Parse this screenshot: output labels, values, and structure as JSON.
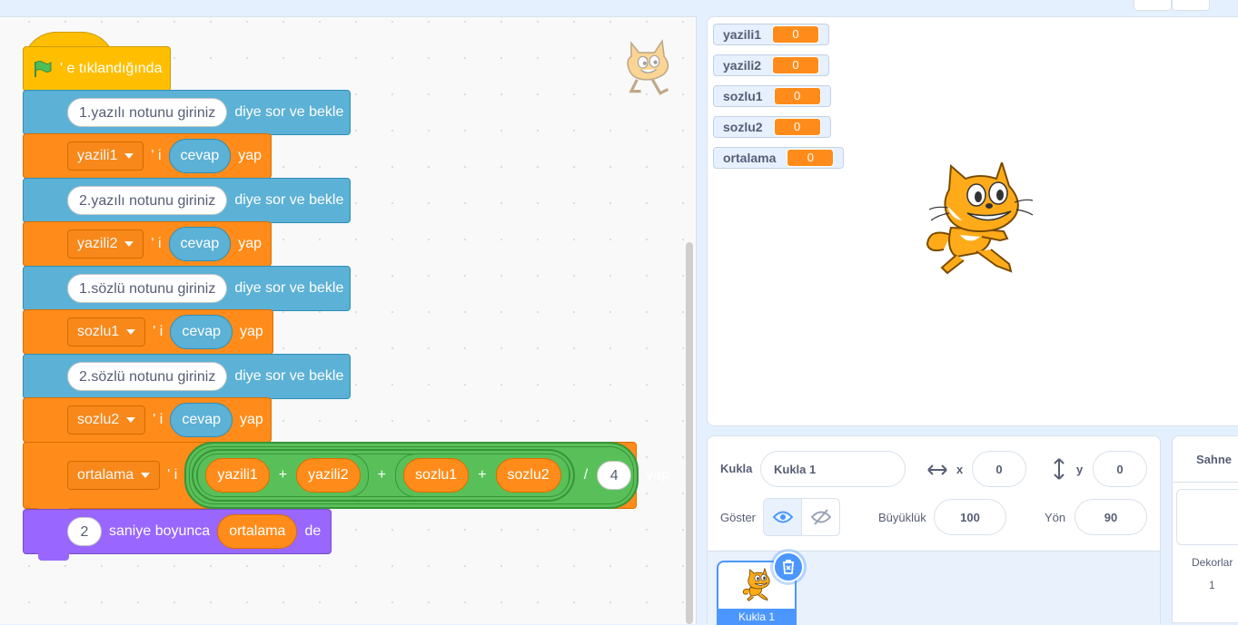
{
  "colors": {
    "events": "#ffbf00",
    "sensing": "#5cb1d6",
    "variables": "#ff8c1a",
    "operators": "#59c059",
    "looks": "#9966ff",
    "accent": "#4c97ff"
  },
  "script": {
    "hat_label": "' e tıklandığında",
    "ask1_text": "1.yazılı notunu giriniz",
    "ask_suffix": "diye sor ve bekle",
    "set1_var": "yazili1",
    "set_mid": "' i",
    "answer": "cevap",
    "yap": "yap",
    "ask2_text": "2.yazılı notunu giriniz",
    "set2_var": "yazili2",
    "ask3_text": "1.sözlü notunu giriniz",
    "set3_var": "sozlu1",
    "ask4_text": "2.sözlü notunu giriniz",
    "set4_var": "sozlu2",
    "set5_var": "ortalama",
    "op_plus": "+",
    "op_div": "/",
    "divisor": "4",
    "r_yazili1": "yazili1",
    "r_yazili2": "yazili2",
    "r_sozlu1": "sozlu1",
    "r_sozlu2": "sozlu2",
    "say_secs": "2",
    "say_label": "saniye boyunca",
    "say_var": "ortalama",
    "say_suffix": "de"
  },
  "monitors": [
    {
      "name": "yazili1",
      "value": "0"
    },
    {
      "name": "yazili2",
      "value": "0"
    },
    {
      "name": "sozlu1",
      "value": "0"
    },
    {
      "name": "sozlu2",
      "value": "0"
    },
    {
      "name": "ortalama",
      "value": "0"
    }
  ],
  "sprite_info": {
    "sprite_label": "Kukla",
    "sprite_name": "Kukla 1",
    "x_label": "x",
    "x_value": "0",
    "y_label": "y",
    "y_value": "0",
    "show_label": "Göster",
    "size_label": "Büyüklük",
    "size_value": "100",
    "direction_label": "Yön",
    "direction_value": "90",
    "tile_label": "Kukla 1"
  },
  "stage_panel": {
    "title": "Sahne",
    "backdrops_label": "Dekorlar",
    "backdrops_count": "1"
  }
}
